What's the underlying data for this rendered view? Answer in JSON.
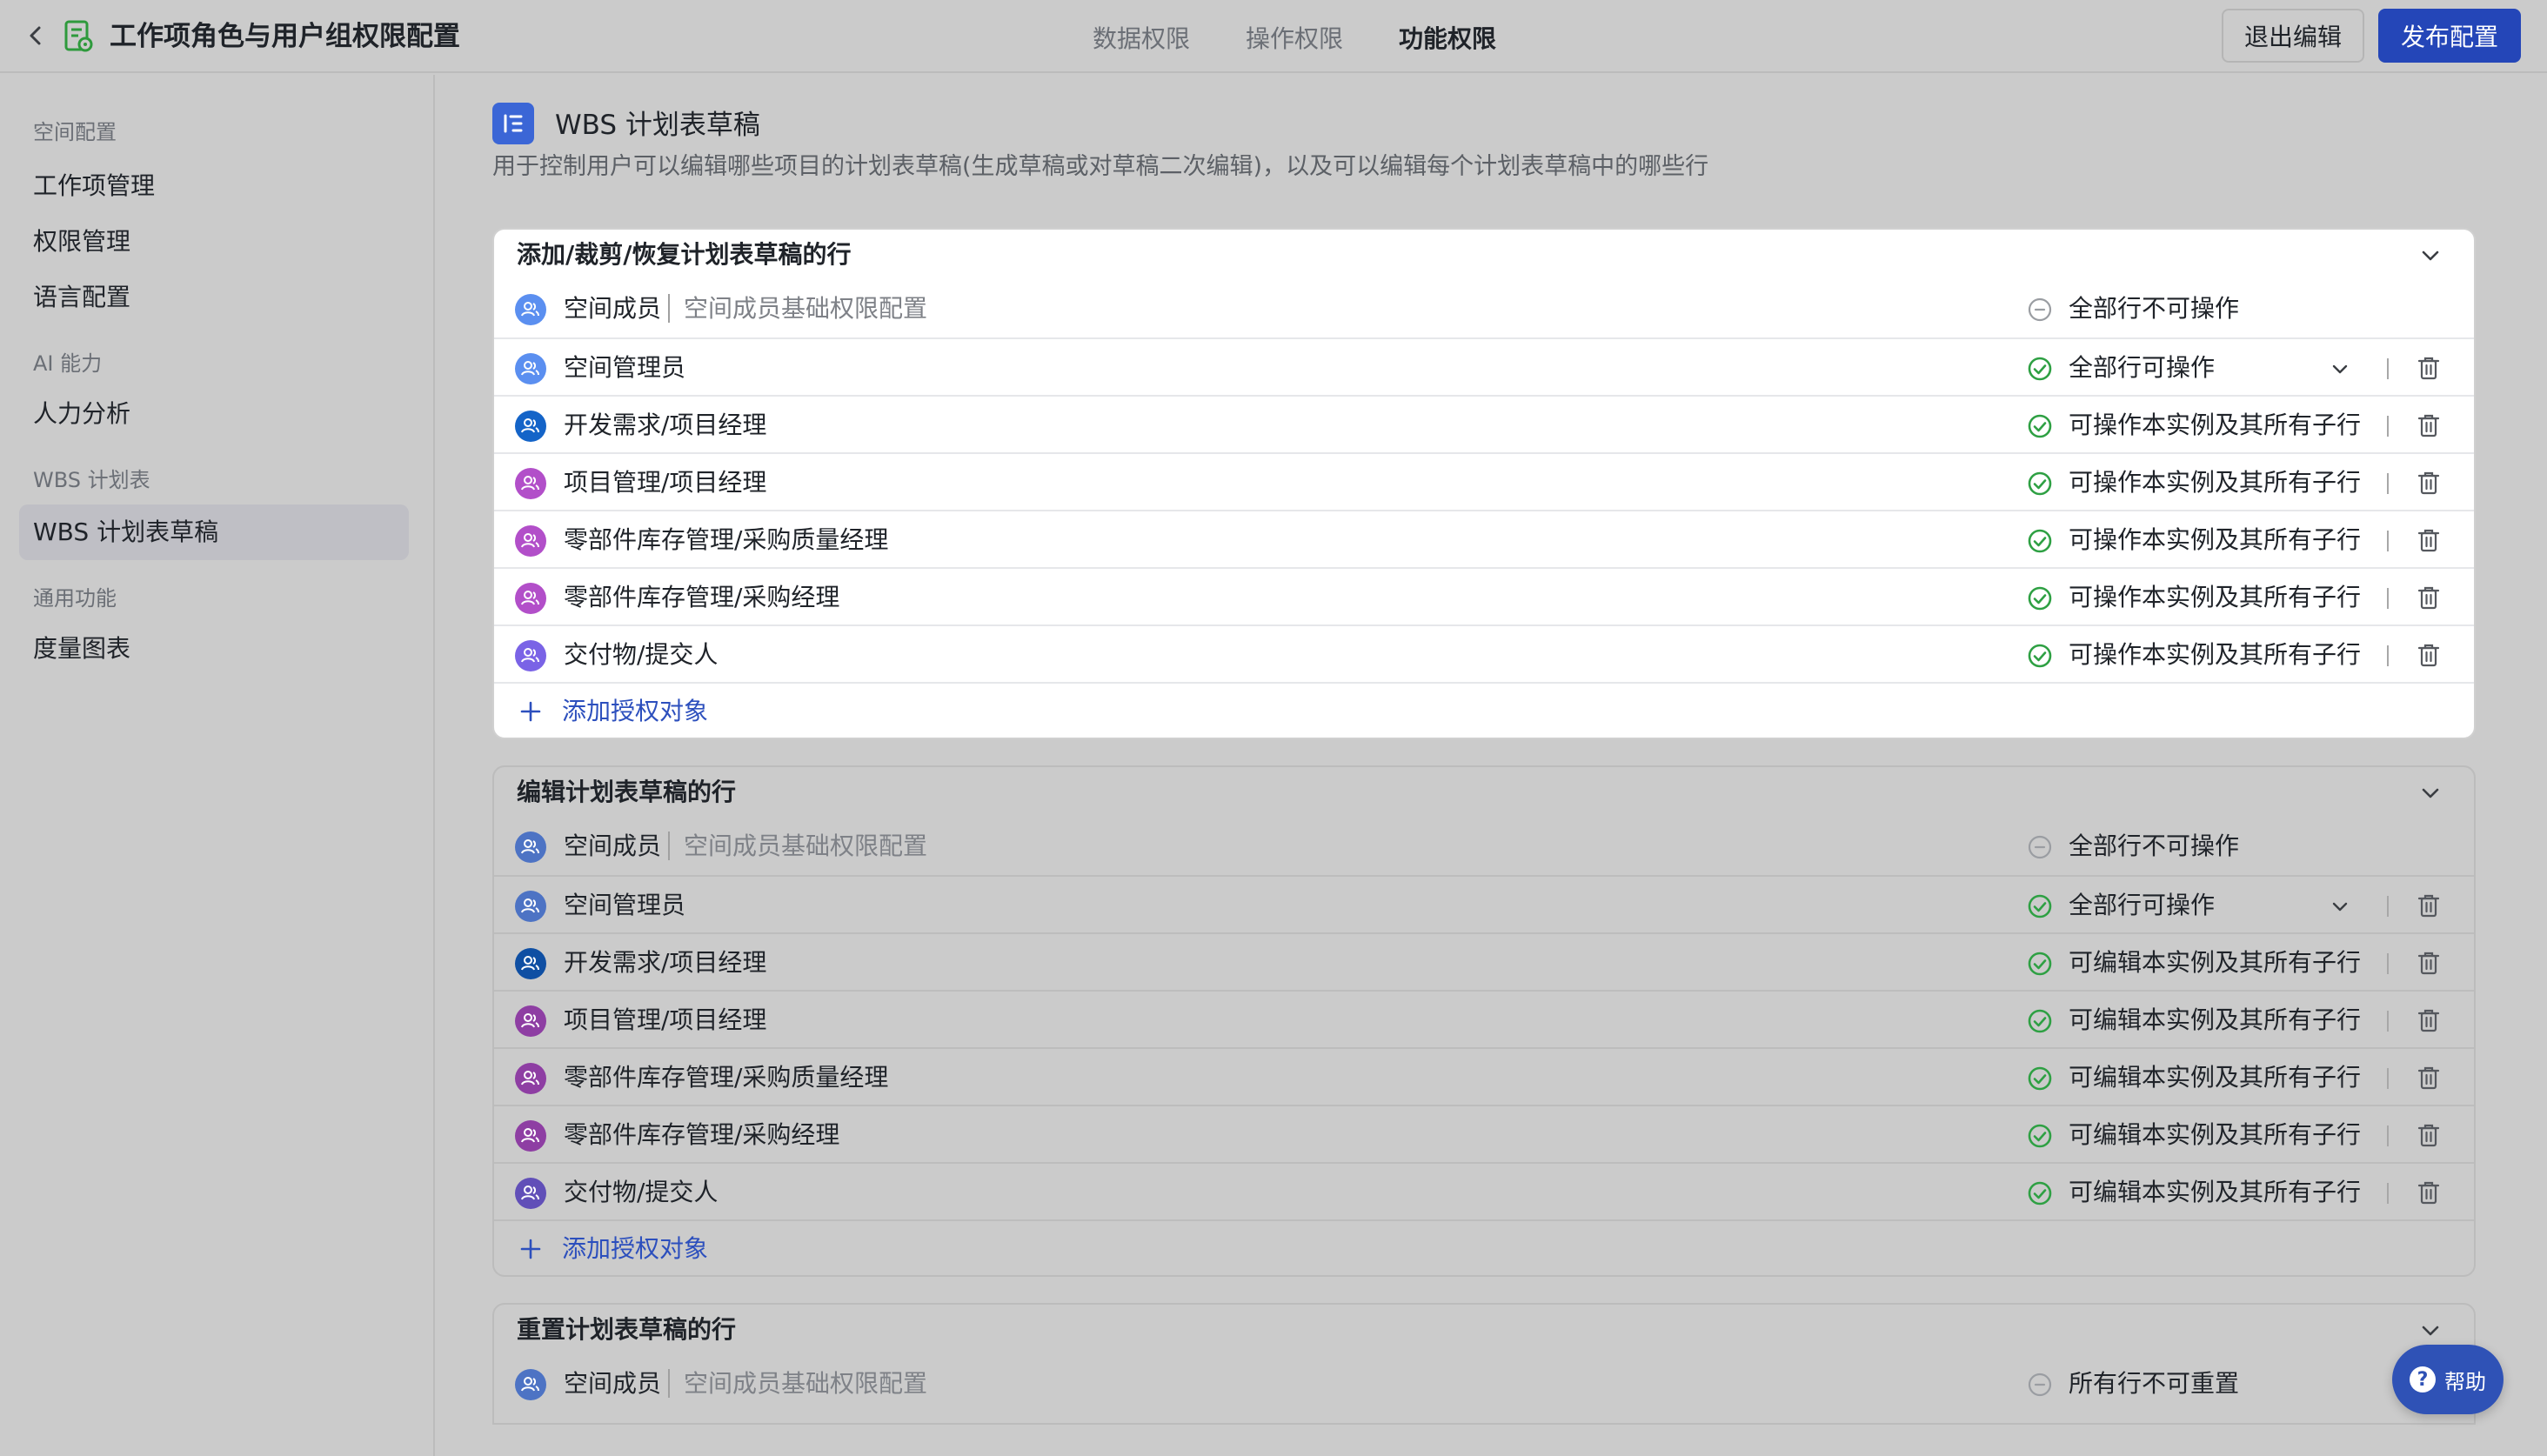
{
  "header": {
    "title": "工作项角色与用户组权限配置",
    "tabs": [
      "数据权限",
      "操作权限",
      "功能权限"
    ],
    "active_tab": "功能权限",
    "exit_label": "退出编辑",
    "publish_label": "发布配置"
  },
  "sidebar": {
    "groups": [
      {
        "label": "空间配置",
        "items": [
          "工作项管理",
          "权限管理",
          "语言配置"
        ]
      },
      {
        "label": "AI 能力",
        "items": [
          "人力分析"
        ]
      },
      {
        "label": "WBS 计划表",
        "items": [
          "WBS 计划表草稿"
        ]
      },
      {
        "label": "通用功能",
        "items": [
          "度量图表"
        ]
      }
    ],
    "active_item": "WBS 计划表草稿"
  },
  "page": {
    "title": "WBS 计划表草稿",
    "description": "用于控制用户可以编辑哪些项目的计划表草稿(生成草稿或对草稿二次编辑)，以及可以编辑每个计划表草稿中的哪些行"
  },
  "sections": [
    {
      "title": "添加/裁剪/恢复计划表草稿的行",
      "rows": [
        {
          "name": "空间成员",
          "sub": "空间成员基础权限配置",
          "perm": "全部行不可操作",
          "status": "none",
          "avatar_color": "#5b8ff0",
          "dropdown": false,
          "deletable": false
        },
        {
          "name": "空间管理员",
          "perm": "全部行可操作",
          "status": "ok",
          "avatar_color": "#5b8ff0",
          "dropdown": true,
          "deletable": true
        },
        {
          "name": "开发需求/项目经理",
          "perm": "可操作本实例及其所有子行",
          "status": "ok",
          "avatar_color": "#1464c8",
          "dropdown": false,
          "deletable": true
        },
        {
          "name": "项目管理/项目经理",
          "perm": "可操作本实例及其所有子行",
          "status": "ok",
          "avatar_color": "#b24fc9",
          "dropdown": false,
          "deletable": true
        },
        {
          "name": "零部件库存管理/采购质量经理",
          "perm": "可操作本实例及其所有子行",
          "status": "ok",
          "avatar_color": "#b24fc9",
          "dropdown": false,
          "deletable": true
        },
        {
          "name": "零部件库存管理/采购经理",
          "perm": "可操作本实例及其所有子行",
          "status": "ok",
          "avatar_color": "#b24fc9",
          "dropdown": false,
          "deletable": true
        },
        {
          "name": "交付物/提交人",
          "perm": "可操作本实例及其所有子行",
          "status": "ok",
          "avatar_color": "#7a63e6",
          "dropdown": false,
          "deletable": true
        }
      ],
      "add_label": "添加授权对象"
    },
    {
      "title": "编辑计划表草稿的行",
      "rows": [
        {
          "name": "空间成员",
          "sub": "空间成员基础权限配置",
          "perm": "全部行不可操作",
          "status": "none",
          "avatar_color": "#4d73c4",
          "dropdown": false,
          "deletable": false
        },
        {
          "name": "空间管理员",
          "perm": "全部行可操作",
          "status": "ok",
          "avatar_color": "#4d73c4",
          "dropdown": true,
          "deletable": true
        },
        {
          "name": "开发需求/项目经理",
          "perm": "可编辑本实例及其所有子行",
          "status": "ok",
          "avatar_color": "#0f4fa3",
          "dropdown": false,
          "deletable": true
        },
        {
          "name": "项目管理/项目经理",
          "perm": "可编辑本实例及其所有子行",
          "status": "ok",
          "avatar_color": "#8e3ea3",
          "dropdown": false,
          "deletable": true
        },
        {
          "name": "零部件库存管理/采购质量经理",
          "perm": "可编辑本实例及其所有子行",
          "status": "ok",
          "avatar_color": "#8e3ea3",
          "dropdown": false,
          "deletable": true
        },
        {
          "name": "零部件库存管理/采购经理",
          "perm": "可编辑本实例及其所有子行",
          "status": "ok",
          "avatar_color": "#8e3ea3",
          "dropdown": false,
          "deletable": true
        },
        {
          "name": "交付物/提交人",
          "perm": "可编辑本实例及其所有子行",
          "status": "ok",
          "avatar_color": "#614fb8",
          "dropdown": false,
          "deletable": true
        }
      ],
      "add_label": "添加授权对象"
    },
    {
      "title": "重置计划表草稿的行",
      "rows": [
        {
          "name": "空间成员",
          "sub": "空间成员基础权限配置",
          "perm": "所有行不可重置",
          "status": "none",
          "avatar_color": "#4d73c4",
          "dropdown": false,
          "deletable": false
        }
      ]
    }
  ],
  "help_label": "帮助",
  "colors": {
    "accent": "#2446b8",
    "ok": "#2ea043",
    "link": "#2c4fbd"
  }
}
